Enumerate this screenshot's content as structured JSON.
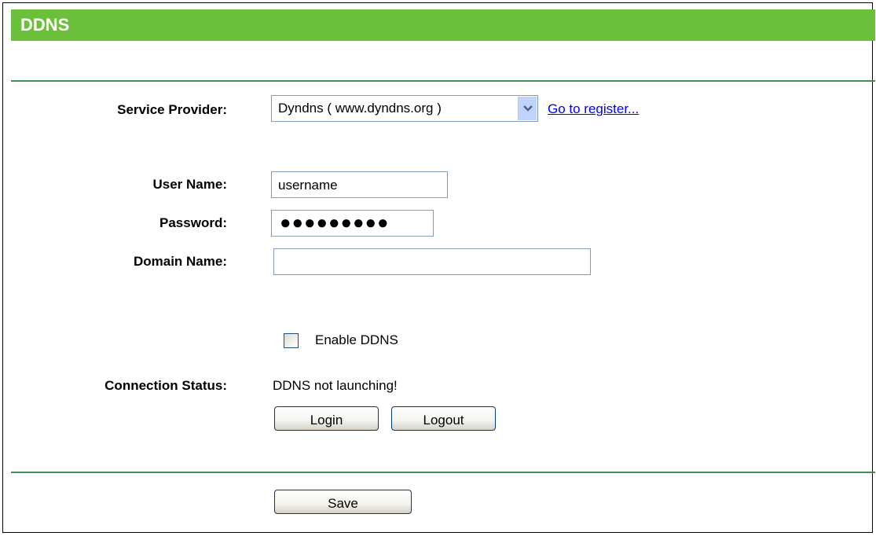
{
  "header": {
    "title": "DDNS"
  },
  "form": {
    "service_provider": {
      "label": "Service Provider:",
      "selected": "Dyndns ( www.dyndns.org )",
      "register_link": "Go to register..."
    },
    "user_name": {
      "label": "User Name:",
      "value": "username"
    },
    "password": {
      "label": "Password:",
      "masked_value": "●●●●●●●●●"
    },
    "domain_name": {
      "label": "Domain Name:",
      "value": ""
    },
    "enable_ddns": {
      "label": "Enable DDNS",
      "checked": false
    },
    "connection_status": {
      "label": "Connection Status:",
      "value": "DDNS not launching!"
    },
    "buttons": {
      "login": "Login",
      "logout": "Logout",
      "save": "Save"
    }
  },
  "colors": {
    "header_bg": "#6cbf3a",
    "divider": "#3f8f53",
    "link": "#0000ee"
  },
  "icons": {
    "dropdown": "chevron-down-icon"
  }
}
